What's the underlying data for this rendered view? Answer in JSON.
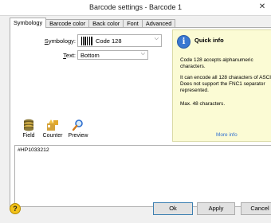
{
  "window": {
    "title": "Barcode settings - Barcode 1",
    "close": "✕"
  },
  "tabs": [
    "Symbology",
    "Barcode color",
    "Back color",
    "Font",
    "Advanced"
  ],
  "form": {
    "symbology_label": "Symbology:",
    "symbology_value": "Code 128",
    "text_label": "Text:",
    "text_value": "Bottom"
  },
  "quick_info": {
    "title": "Quick info",
    "icon": "info-icon",
    "lines": [
      "Code 128 accepts alphanumeric characters.",
      "It can encode all 128 characters of ASCII. Does not support the FNC1 separator represented.",
      "Max. 48 characters."
    ],
    "more": "More info"
  },
  "tools": [
    {
      "label": "Field",
      "icon": "database-icon"
    },
    {
      "label": "Counter",
      "icon": "counter-icon"
    },
    {
      "label": "Preview",
      "icon": "magnifier-icon"
    }
  ],
  "content": "#HP1033212",
  "buttons": {
    "ok": "Ok",
    "apply": "Apply",
    "cancel": "Cancel"
  },
  "colors": {
    "window_bg": "#f0f0f0",
    "info_bg": "#fbfbd4",
    "info_icon": "#3a78d1",
    "link": "#2f6fd0",
    "help": "#f2c21a"
  }
}
